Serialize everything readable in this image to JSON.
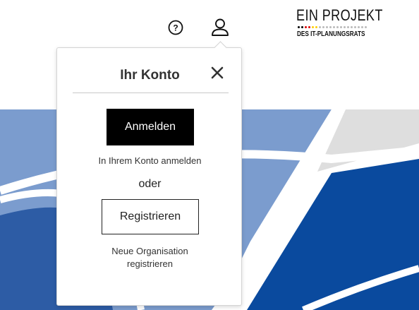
{
  "header": {
    "help_icon": "question-circle-icon",
    "user_icon": "user-icon",
    "logo": {
      "line1": "EIN PROJEKT",
      "line2": "DES IT-PLANUNGSRATS",
      "dot_colors": [
        "#000000",
        "#dd0000",
        "#ffce00"
      ]
    }
  },
  "account_popup": {
    "title": "Ihr Konto",
    "close_icon": "close-icon",
    "login_button": "Anmelden",
    "login_hint": "In Ihrem Konto anmelden",
    "separator": "oder",
    "register_button": "Registrieren",
    "register_hint_line1": "Neue Organisation",
    "register_hint_line2": "registrieren"
  },
  "colors": {
    "hero_light_blue": "#7b9cce",
    "hero_dark_blue": "#0a4a9e",
    "hero_grey": "#dedede",
    "button_black": "#000000"
  }
}
